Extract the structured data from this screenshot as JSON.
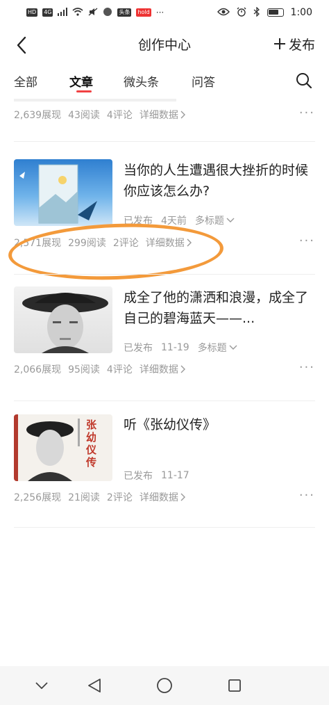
{
  "status_bar": {
    "left_chips": [
      "HD",
      "4G"
    ],
    "app_badges": [
      "头条",
      "hold"
    ],
    "time": "1:00"
  },
  "header": {
    "title": "创作中心",
    "publish_label": "发布"
  },
  "tabs": [
    {
      "label": "全部"
    },
    {
      "label": "文章"
    },
    {
      "label": "微头条"
    },
    {
      "label": "问答"
    }
  ],
  "articles": [
    {
      "stats": {
        "views": "2,639展现",
        "reads": "43阅读",
        "comments": "4评论",
        "detail": "详细数据"
      }
    },
    {
      "title": "当你的人生遭遇很大挫折的时候你应该怎么办?",
      "status": "已发布",
      "time": "4天前",
      "multi_title": "多标题",
      "stats": {
        "views": "2,571展现",
        "reads": "299阅读",
        "comments": "2评论",
        "detail": "详细数据"
      }
    },
    {
      "title": "成全了他的潇洒和浪漫，成全了自己的碧海蓝天——...",
      "status": "已发布",
      "time": "11-19",
      "multi_title": "多标题",
      "stats": {
        "views": "2,066展现",
        "reads": "95阅读",
        "comments": "4评论",
        "detail": "详细数据"
      }
    },
    {
      "title": "听《张幼仪传》",
      "status": "已发布",
      "time": "11-17",
      "cover_text": "张幼仪传",
      "stats": {
        "views": "2,256展现",
        "reads": "21阅读",
        "comments": "2评论",
        "detail": "详细数据"
      }
    }
  ],
  "colors": {
    "accent": "#f04142",
    "annotation": "#f39a3b",
    "muted": "#999999"
  }
}
